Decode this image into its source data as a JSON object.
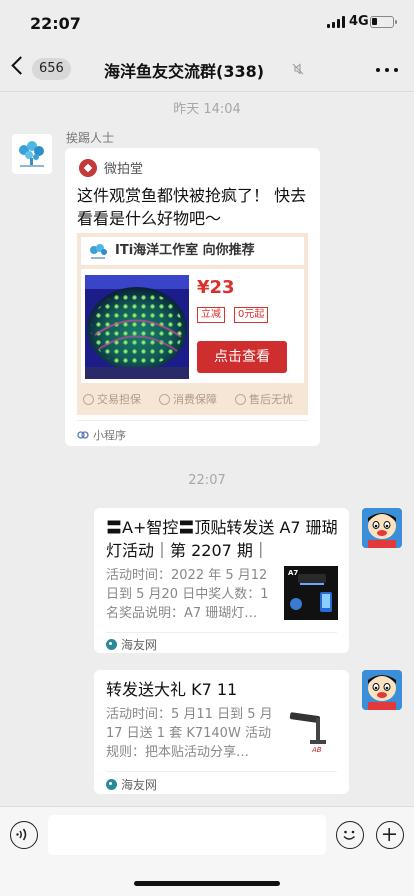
{
  "status": {
    "time": "22:07",
    "network": "4G"
  },
  "nav": {
    "back_count": "656",
    "title": "海洋鱼友交流群(338)"
  },
  "timestamps": [
    "昨天 14:04",
    "22:07"
  ],
  "mini_program_message": {
    "sender": "挨踢人士",
    "source": "微拍堂",
    "text": "这件观赏鱼都快被抢疯了！ 快去看看是什么好物吧～",
    "card": {
      "shop_header": "ITi海洋工作室 向你推荐",
      "price": "¥23",
      "tags": [
        "立减",
        "0元起"
      ],
      "button": "点击查看",
      "guarantees": [
        "交易担保",
        "消费保障",
        "售后无忧"
      ]
    },
    "footer": "小程序"
  },
  "article_messages": [
    {
      "title": "〓A+智控〓顶贴转发送 A7 珊瑚灯活动｜第 2207 期｜",
      "desc": "活动时间：2022 年 5 月12 日到 5 月20 日中奖人数：1 名奖品说明：A7 珊瑚灯…",
      "source": "海友网",
      "thumb_label": "A7"
    },
    {
      "title": "转发送大礼 K7 11",
      "desc": "活动时间：5 月11 日到 5 月17 日送 1 套 K7140W 活动规则：把本贴活动分享…",
      "source": "海友网",
      "thumb_label": "AB"
    }
  ],
  "colors": {
    "price_red": "#d9312c",
    "buy_button": "#cf2e2e",
    "chat_bg": "#ededed"
  }
}
